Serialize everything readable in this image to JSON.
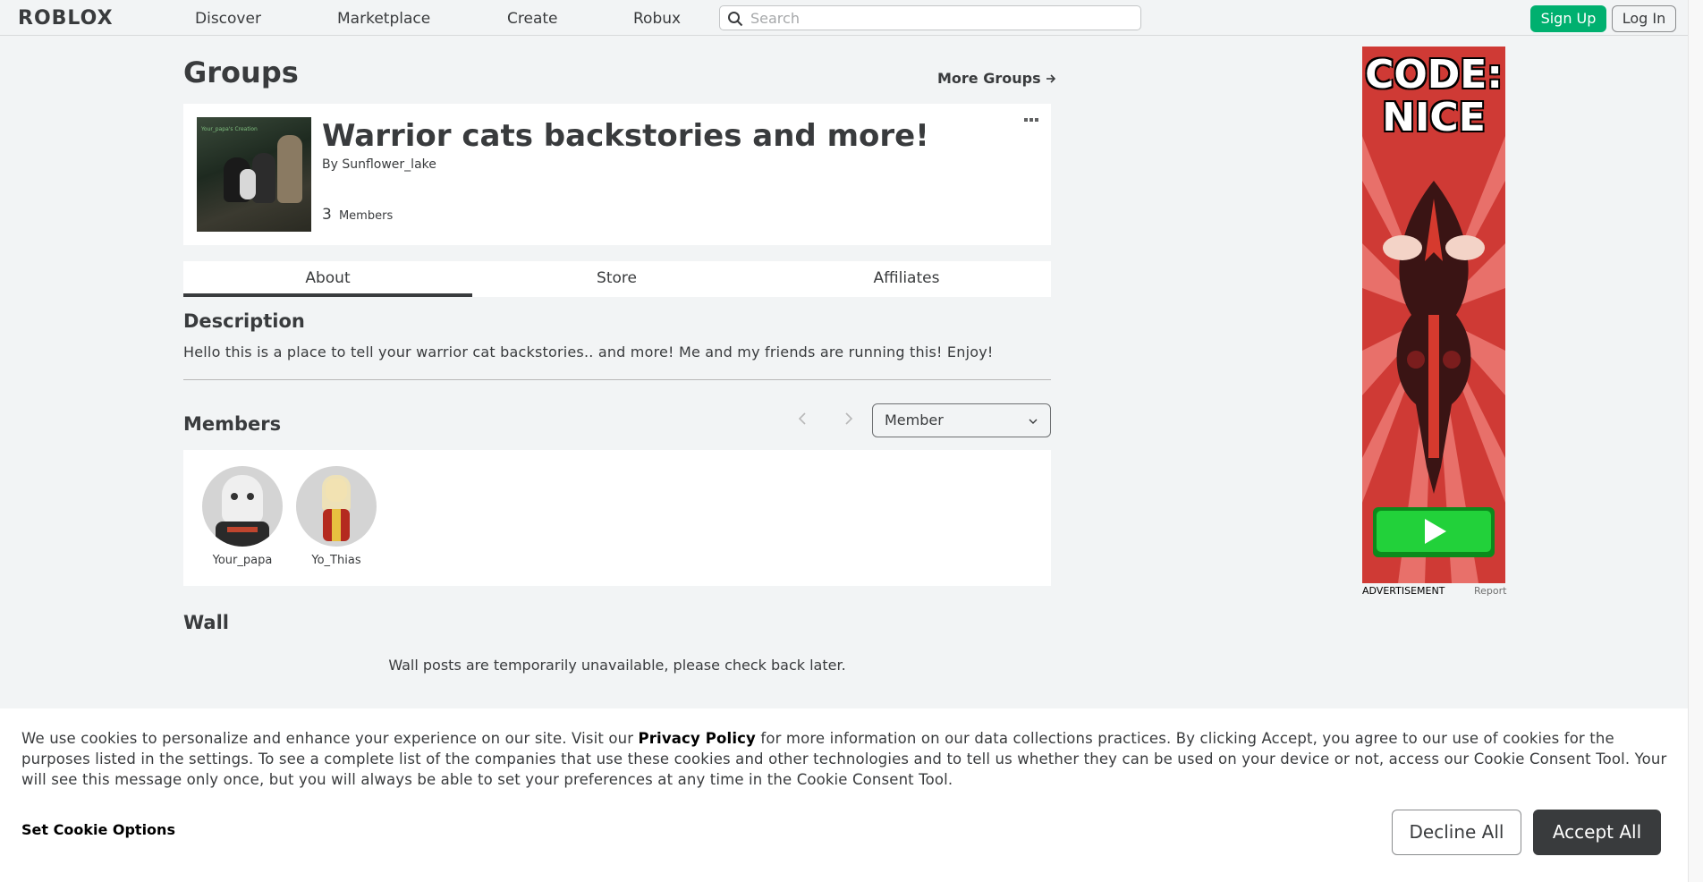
{
  "header": {
    "logo": "ROBLOX",
    "nav": [
      "Discover",
      "Marketplace",
      "Create",
      "Robux"
    ],
    "search_placeholder": "Search",
    "signup_label": "Sign Up",
    "login_label": "Log In"
  },
  "page": {
    "title": "Groups",
    "more_groups_label": "More Groups"
  },
  "group": {
    "thumb_overlay_text": "Your_papa's Creation",
    "name": "Warrior cats backstories and more!",
    "by_label": "By",
    "owner": "Sunflower_lake",
    "member_count": "3",
    "members_label": "Members"
  },
  "tabs": [
    "About",
    "Store",
    "Affiliates"
  ],
  "description": {
    "title": "Description",
    "text": "Hello this is a place to tell your warrior cat backstories.. and more! Me and my friends are running this! Enjoy!"
  },
  "members": {
    "title": "Members",
    "role_selected": "Member",
    "list": [
      {
        "name": "Your_papa"
      },
      {
        "name": "Yo_Thias"
      }
    ]
  },
  "wall": {
    "title": "Wall",
    "message": "Wall posts are temporarily unavailable, please check back later."
  },
  "ad": {
    "headline_1": "CODE:",
    "headline_2": "NICE",
    "label": "ADVERTISEMENT",
    "report": "Report"
  },
  "cookie": {
    "text_before": "We use cookies to personalize and enhance your experience on our site. Visit our ",
    "privacy_link": "Privacy Policy",
    "text_after": " for more information on our data collections practices. By clicking Accept, you agree to our use of cookies for the purposes listed in the settings. To see a complete list of the companies that use these cookies and other technologies and to tell us whether they can be used on your device or not, access our Cookie Consent Tool. Your will see this message only once, but you will always be able to set your preferences at any time in the Cookie Consent Tool.",
    "options_label": "Set Cookie Options",
    "decline_label": "Decline All",
    "accept_label": "Accept All"
  },
  "colors": {
    "signup_green": "#00b06f",
    "accept_dark": "#393b3d",
    "ad_red": "#cf3a35"
  }
}
